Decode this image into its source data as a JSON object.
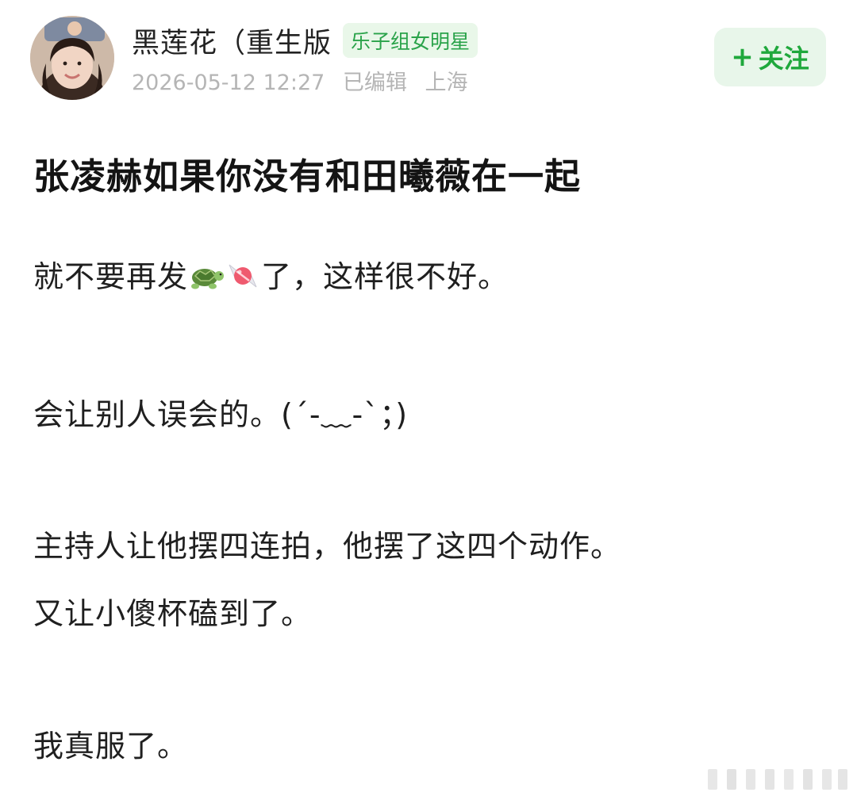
{
  "post": {
    "username": "黑莲花（重生版",
    "badge": "乐子组女明星",
    "date": "2026-05-12 12:27",
    "edited": "已编辑",
    "location": "上海",
    "follow_label": "关注",
    "follow_plus": "+",
    "title": "张凌赫如果你没有和田曦薇在一起",
    "para1_before": "就不要再发",
    "para1_after": "了，这样很不好。",
    "para2": "会让别人误会的。(´-﹏-`；)",
    "para3_line1": "主持人让他摆四连拍，他摆了这四个动作。",
    "para3_line2": "又让小傻杯磕到了。",
    "para4": "我真服了。"
  },
  "icons": {
    "emoji1": "turtle-emoji-icon",
    "emoji2": "candy-emoji-icon",
    "watermark": "watermark-bars-icon"
  },
  "colors": {
    "accent_green": "#1fa83c",
    "badge_bg": "#e9f7e9",
    "follow_bg": "#e8f6ea",
    "meta_gray": "#b5b5b5"
  }
}
